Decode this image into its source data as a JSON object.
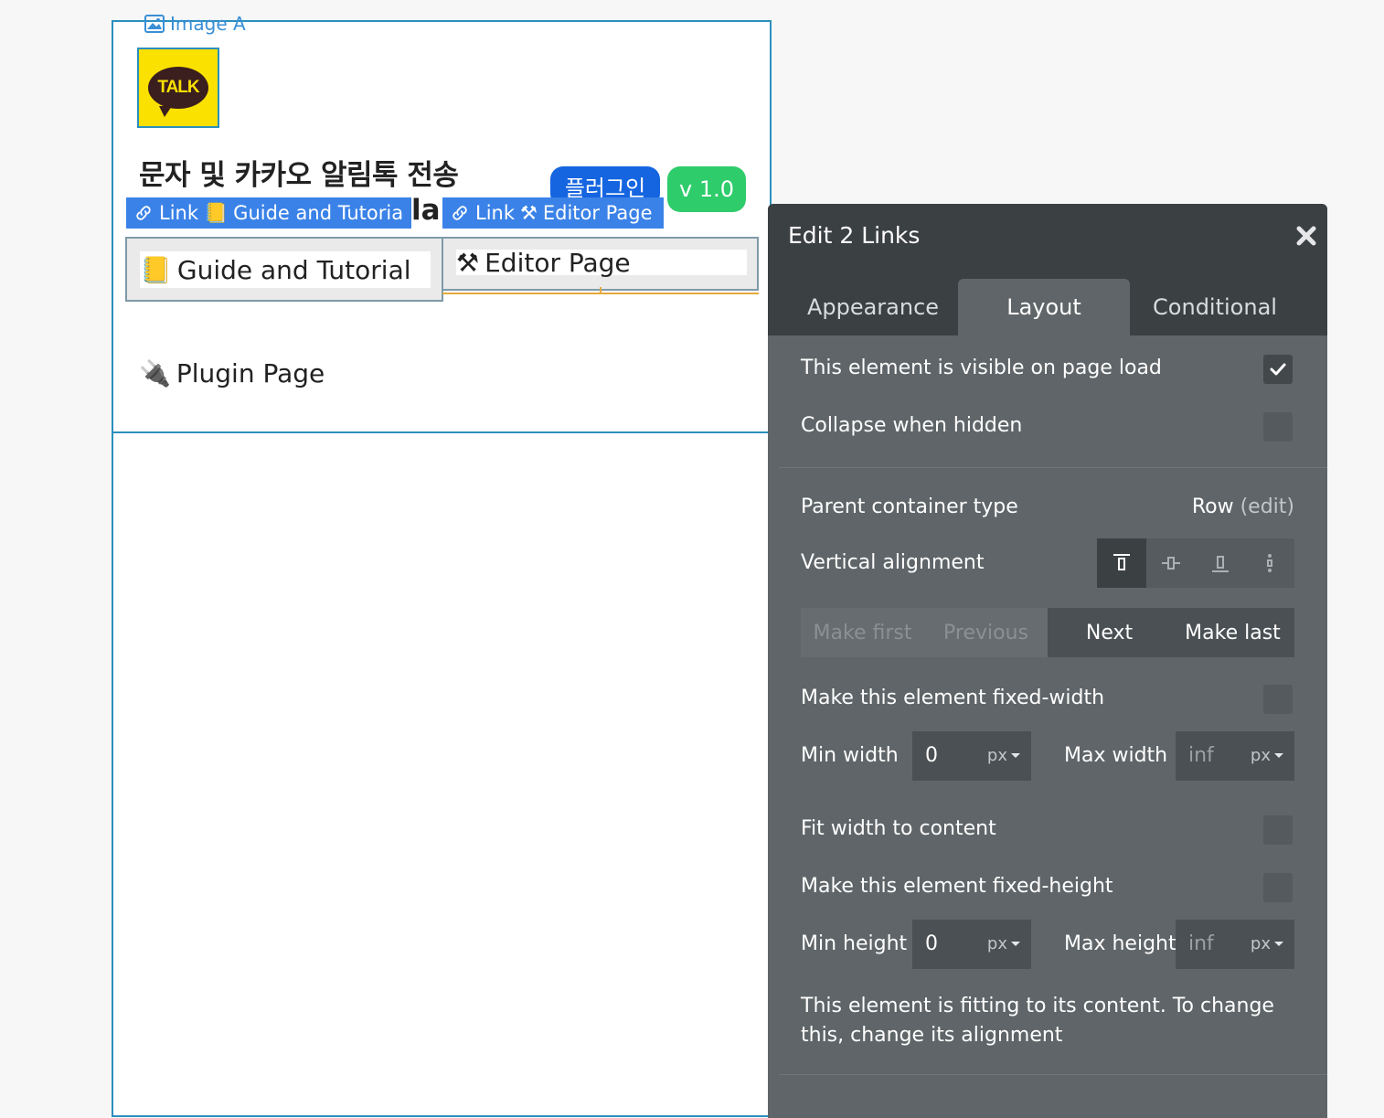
{
  "canvas": {
    "image_label": "Image A",
    "logo_text": "TALK",
    "headline": "문자 및 카카오 알림톡 전송",
    "headline_tail": "la",
    "plugin_pill": "플러그인",
    "version_pill": "v 1.0",
    "link_tags": [
      {
        "prefix": "Link",
        "emoji": "📒",
        "text": "Guide and Tutoria"
      },
      {
        "prefix": "Link",
        "emoji": "⚒",
        "text": "Editor Page"
      }
    ],
    "links": [
      {
        "emoji": "📒",
        "text": "Guide and Tutorial"
      },
      {
        "emoji": "⚒",
        "text": "Editor Page"
      },
      {
        "emoji": "🔌",
        "text": "Plugin Page"
      }
    ]
  },
  "panel": {
    "title": "Edit 2 Links",
    "tabs": [
      "Appearance",
      "Layout",
      "Conditional"
    ],
    "active_tab": "Layout",
    "visible_on_load": {
      "label": "This element is visible on page load",
      "checked": true
    },
    "collapse_when_hidden": {
      "label": "Collapse when hidden",
      "checked": false
    },
    "parent_container": {
      "label": "Parent container type",
      "value": "Row",
      "edit": "(edit)"
    },
    "vertical_alignment": {
      "label": "Vertical alignment",
      "options": [
        "top",
        "center",
        "bottom",
        "stretch"
      ],
      "selected": "top"
    },
    "order_buttons": [
      "Make first",
      "Previous",
      "Next",
      "Make last"
    ],
    "fixed_width": {
      "label": "Make this element fixed-width",
      "checked": false
    },
    "min_width": {
      "label": "Min width",
      "value": "0",
      "unit": "px"
    },
    "max_width": {
      "label": "Max width",
      "placeholder": "inf",
      "unit": "px"
    },
    "fit_width": {
      "label": "Fit width to content",
      "checked": false
    },
    "fixed_height": {
      "label": "Make this element fixed-height",
      "checked": false
    },
    "min_height": {
      "label": "Min height",
      "value": "0",
      "unit": "px"
    },
    "max_height": {
      "label": "Max height",
      "placeholder": "inf",
      "unit": "px"
    },
    "note": "This element is fitting to its content. To change this, change its alignment"
  }
}
